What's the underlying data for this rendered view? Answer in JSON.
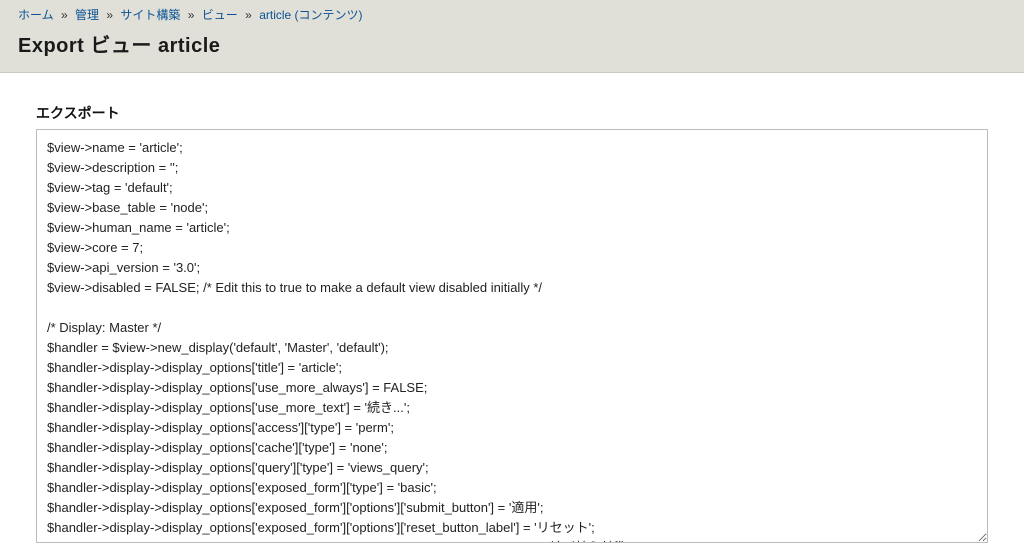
{
  "breadcrumb": {
    "items": [
      {
        "label": "ホーム"
      },
      {
        "label": "管理"
      },
      {
        "label": "サイト構築"
      },
      {
        "label": "ビュー"
      },
      {
        "label": "article (コンテンツ)"
      }
    ],
    "sep": "»"
  },
  "page": {
    "title": "Export ビュー article",
    "fieldset_label": "エクスポート"
  },
  "export": {
    "code": "$view->name = 'article';\n$view->description = '';\n$view->tag = 'default';\n$view->base_table = 'node';\n$view->human_name = 'article';\n$view->core = 7;\n$view->api_version = '3.0';\n$view->disabled = FALSE; /* Edit this to true to make a default view disabled initially */\n\n/* Display: Master */\n$handler = $view->new_display('default', 'Master', 'default');\n$handler->display->display_options['title'] = 'article';\n$handler->display->display_options['use_more_always'] = FALSE;\n$handler->display->display_options['use_more_text'] = '続き...';\n$handler->display->display_options['access']['type'] = 'perm';\n$handler->display->display_options['cache']['type'] = 'none';\n$handler->display->display_options['query']['type'] = 'views_query';\n$handler->display->display_options['exposed_form']['type'] = 'basic';\n$handler->display->display_options['exposed_form']['options']['submit_button'] = '適用';\n$handler->display->display_options['exposed_form']['options']['reset_button_label'] = 'リセット';\n$handler->display->display_options['exposed_form']['options']['exposed_sorts_label'] = '並び替え基準';"
  }
}
